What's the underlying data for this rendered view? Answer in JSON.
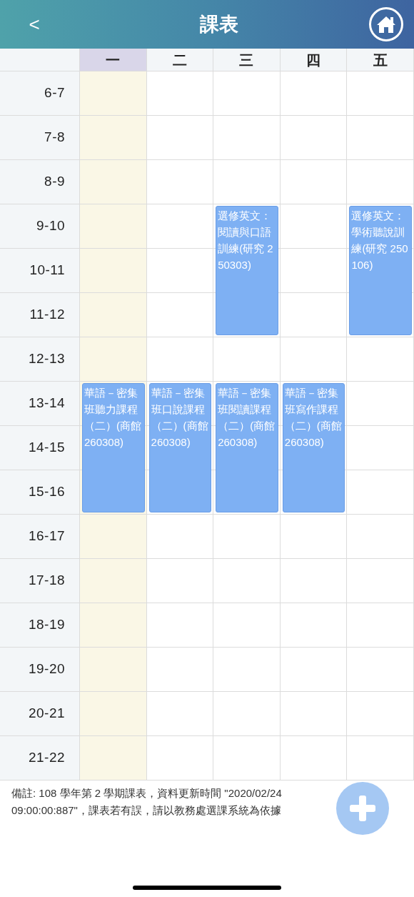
{
  "header": {
    "back": "<",
    "title": "課表"
  },
  "times": [
    "6-7",
    "7-8",
    "8-9",
    "9-10",
    "10-11",
    "11-12",
    "12-13",
    "13-14",
    "14-15",
    "15-16",
    "16-17",
    "17-18",
    "18-19",
    "19-20",
    "20-21",
    "21-22"
  ],
  "days": [
    {
      "label": "一",
      "selected": true,
      "slots": [
        {
          "kind": "free"
        },
        {
          "kind": "free"
        },
        {
          "kind": "free"
        },
        {
          "kind": "free"
        },
        {
          "kind": "free"
        },
        {
          "kind": "free"
        },
        {
          "kind": "free"
        },
        {
          "kind": "course",
          "title": "華語－密集班聽力課程（二）(商館 260308)"
        },
        {
          "kind": "cont"
        },
        {
          "kind": "cont"
        },
        {
          "kind": "free"
        },
        {
          "kind": "free"
        },
        {
          "kind": "free"
        },
        {
          "kind": "free"
        },
        {
          "kind": "free"
        },
        {
          "kind": "free"
        }
      ]
    },
    {
      "label": "二",
      "selected": false,
      "slots": [
        {
          "kind": "free"
        },
        {
          "kind": "free"
        },
        {
          "kind": "free"
        },
        {
          "kind": "free"
        },
        {
          "kind": "free"
        },
        {
          "kind": "free"
        },
        {
          "kind": "free"
        },
        {
          "kind": "course",
          "title": "華語－密集班口說課程（二）(商館 260308)"
        },
        {
          "kind": "cont"
        },
        {
          "kind": "cont"
        },
        {
          "kind": "free"
        },
        {
          "kind": "free"
        },
        {
          "kind": "free"
        },
        {
          "kind": "free"
        },
        {
          "kind": "free"
        },
        {
          "kind": "free"
        }
      ]
    },
    {
      "label": "三",
      "selected": false,
      "slots": [
        {
          "kind": "free"
        },
        {
          "kind": "free"
        },
        {
          "kind": "free"
        },
        {
          "kind": "course",
          "title": "選修英文：閱讀與口語訓練(研究 250303)"
        },
        {
          "kind": "cont"
        },
        {
          "kind": "cont"
        },
        {
          "kind": "free"
        },
        {
          "kind": "course",
          "title": "華語－密集班閱讀課程（二）(商館 260308)"
        },
        {
          "kind": "cont"
        },
        {
          "kind": "cont"
        },
        {
          "kind": "free"
        },
        {
          "kind": "free"
        },
        {
          "kind": "free"
        },
        {
          "kind": "free"
        },
        {
          "kind": "free"
        },
        {
          "kind": "free"
        }
      ]
    },
    {
      "label": "四",
      "selected": false,
      "slots": [
        {
          "kind": "free"
        },
        {
          "kind": "free"
        },
        {
          "kind": "free"
        },
        {
          "kind": "free"
        },
        {
          "kind": "free"
        },
        {
          "kind": "free"
        },
        {
          "kind": "free"
        },
        {
          "kind": "course",
          "title": "華語－密集班寫作課程（二）(商館 260308)"
        },
        {
          "kind": "cont"
        },
        {
          "kind": "cont"
        },
        {
          "kind": "free"
        },
        {
          "kind": "free"
        },
        {
          "kind": "free"
        },
        {
          "kind": "free"
        },
        {
          "kind": "free"
        },
        {
          "kind": "free"
        }
      ]
    },
    {
      "label": "五",
      "selected": false,
      "slots": [
        {
          "kind": "free"
        },
        {
          "kind": "free"
        },
        {
          "kind": "free"
        },
        {
          "kind": "course",
          "title": "選修英文：學術聽說訓練(研究 250106)"
        },
        {
          "kind": "cont"
        },
        {
          "kind": "cont"
        },
        {
          "kind": "free"
        },
        {
          "kind": "free"
        },
        {
          "kind": "free"
        },
        {
          "kind": "free"
        },
        {
          "kind": "free"
        },
        {
          "kind": "free"
        },
        {
          "kind": "free"
        },
        {
          "kind": "free"
        },
        {
          "kind": "free"
        },
        {
          "kind": "free"
        }
      ]
    }
  ],
  "note": "備註: 108 學年第 2 學期課表，資料更新時間 \"2020/02/24 09:00:00:887\"，課表若有誤，請以教務處選課系統為依據"
}
